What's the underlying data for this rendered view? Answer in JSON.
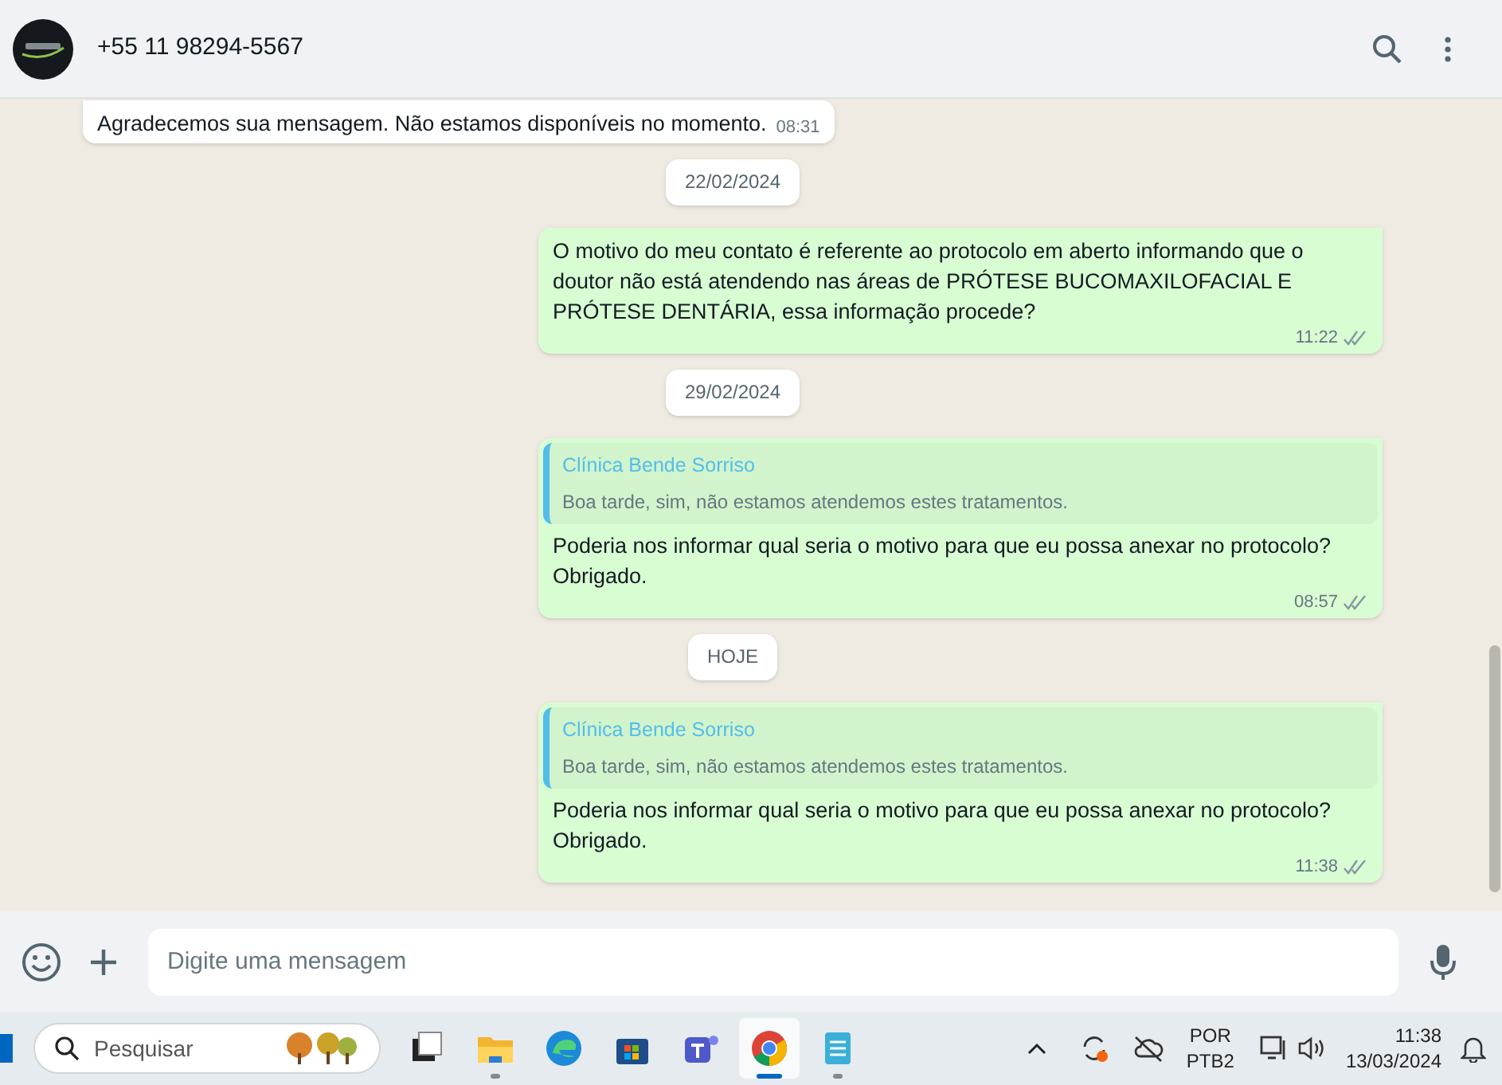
{
  "header": {
    "contact": "+55 11 98294-5567"
  },
  "messages": [
    {
      "kind": "message",
      "sent": false,
      "text": "Agradecemos sua mensagem. Não estamos disponíveis no momento.",
      "time": "08:31",
      "read": false
    },
    {
      "kind": "date",
      "text": "22/02/2024"
    },
    {
      "kind": "message",
      "sent": true,
      "text": "O motivo do meu contato é referente ao protocolo em aberto informando que o doutor não está atendendo nas áreas de PRÓTESE BUCOMAXILOFACIAL E PRÓTESE DENTÁRIA, essa informação procede?",
      "time": "11:22",
      "read": true
    },
    {
      "kind": "date",
      "text": "29/02/2024"
    },
    {
      "kind": "message",
      "sent": true,
      "quote": {
        "author": "Clínica Bende Sorriso",
        "text": "Boa tarde, sim, não estamos atendemos estes tratamentos."
      },
      "text": "Poderia nos informar qual seria o motivo para que eu possa anexar no protocolo? Obrigado.",
      "time": "08:57",
      "read": true
    },
    {
      "kind": "date",
      "text": "HOJE"
    },
    {
      "kind": "message",
      "sent": true,
      "quote": {
        "author": "Clínica Bende Sorriso",
        "text": "Boa tarde, sim, não estamos atendemos estes tratamentos."
      },
      "text": "Poderia nos informar qual seria o motivo para que eu possa anexar no protocolo? Obrigado.",
      "time": "11:38",
      "read": true
    }
  ],
  "composer": {
    "placeholder": "Digite uma mensagem"
  },
  "taskbar": {
    "search_placeholder": "Pesquisar",
    "apps": [
      {
        "kind": "desktop",
        "selected": false,
        "running": false
      },
      {
        "kind": "folder",
        "selected": false,
        "running": true
      },
      {
        "kind": "edge",
        "selected": false,
        "running": false
      },
      {
        "kind": "store",
        "selected": false,
        "running": false
      },
      {
        "kind": "teams",
        "selected": false,
        "running": false
      },
      {
        "kind": "chrome",
        "selected": true,
        "running": true
      },
      {
        "kind": "notepad",
        "selected": false,
        "running": true
      }
    ],
    "language": [
      "POR",
      "PTB2"
    ],
    "time": "11:38",
    "date": "13/03/2024"
  }
}
